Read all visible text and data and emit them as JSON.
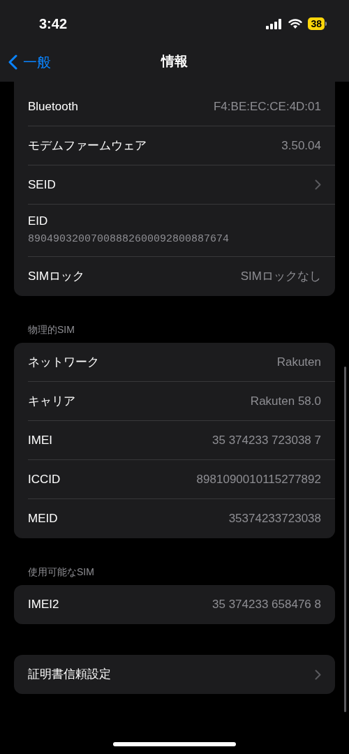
{
  "status_bar": {
    "time": "3:42",
    "battery": "38"
  },
  "nav": {
    "back": "一般",
    "title": "情報"
  },
  "groups": [
    {
      "rows": [
        {
          "kind": "value",
          "label": "Bluetooth",
          "value": "F4:BE:EC:CE:4D:01"
        },
        {
          "kind": "value",
          "label": "モデムファームウェア",
          "value": "3.50.04"
        },
        {
          "kind": "chevron",
          "label": "SEID"
        },
        {
          "kind": "stacked",
          "label": "EID",
          "value": "89049032007008882600092800887674"
        },
        {
          "kind": "value",
          "label": "SIMロック",
          "value": "SIMロックなし"
        }
      ]
    },
    {
      "header": "物理的SIM",
      "rows": [
        {
          "kind": "value",
          "label": "ネットワーク",
          "value": "Rakuten"
        },
        {
          "kind": "value",
          "label": "キャリア",
          "value": "Rakuten 58.0"
        },
        {
          "kind": "value",
          "label": "IMEI",
          "value": "35 374233 723038 7"
        },
        {
          "kind": "value",
          "label": "ICCID",
          "value": "8981090010115277892"
        },
        {
          "kind": "value",
          "label": "MEID",
          "value": "35374233723038"
        }
      ]
    },
    {
      "header": "使用可能なSIM",
      "rows": [
        {
          "kind": "value",
          "label": "IMEI2",
          "value": "35 374233 658476 8"
        }
      ]
    },
    {
      "rows": [
        {
          "kind": "chevron",
          "label": "証明書信頼設定"
        }
      ]
    }
  ]
}
